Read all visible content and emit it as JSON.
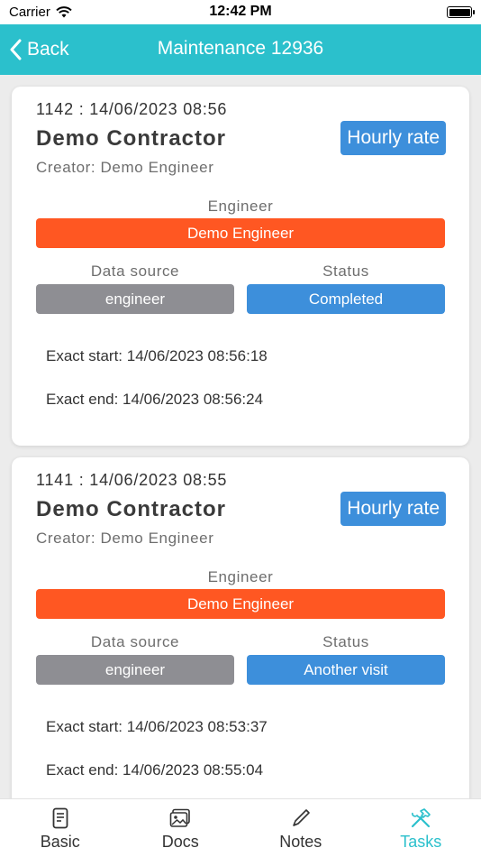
{
  "status_bar": {
    "carrier": "Carrier",
    "time": "12:42 PM"
  },
  "nav": {
    "back_label": "Back",
    "title": "Maintenance 12936"
  },
  "labels": {
    "engineer": "Engineer",
    "data_source": "Data source",
    "status": "Status"
  },
  "tasks": [
    {
      "id_time": "1142 : 14/06/2023 08:56",
      "contractor": "Demo Contractor",
      "creator": "Creator: Demo Engineer",
      "rate": "Hourly rate",
      "engineer": "Demo Engineer",
      "data_source": "engineer",
      "status": "Completed",
      "exact_start": "Exact start: 14/06/2023 08:56:18",
      "exact_end": "Exact end: 14/06/2023 08:56:24"
    },
    {
      "id_time": "1141 : 14/06/2023 08:55",
      "contractor": "Demo Contractor",
      "creator": "Creator: Demo Engineer",
      "rate": "Hourly rate",
      "engineer": "Demo Engineer",
      "data_source": "engineer",
      "status": "Another visit",
      "exact_start": "Exact start: 14/06/2023 08:53:37",
      "exact_end": "Exact end: 14/06/2023 08:55:04"
    }
  ],
  "tabs": [
    {
      "label": "Basic",
      "icon": "document-icon"
    },
    {
      "label": "Docs",
      "icon": "photo-icon"
    },
    {
      "label": "Notes",
      "icon": "pencil-icon"
    },
    {
      "label": "Tasks",
      "icon": "tools-icon",
      "active": true
    }
  ],
  "colors": {
    "accent": "#2bc0cc",
    "engineer_pill": "#ff5722",
    "source_pill": "#8e8e93",
    "status_pill": "#3d8fdb"
  }
}
